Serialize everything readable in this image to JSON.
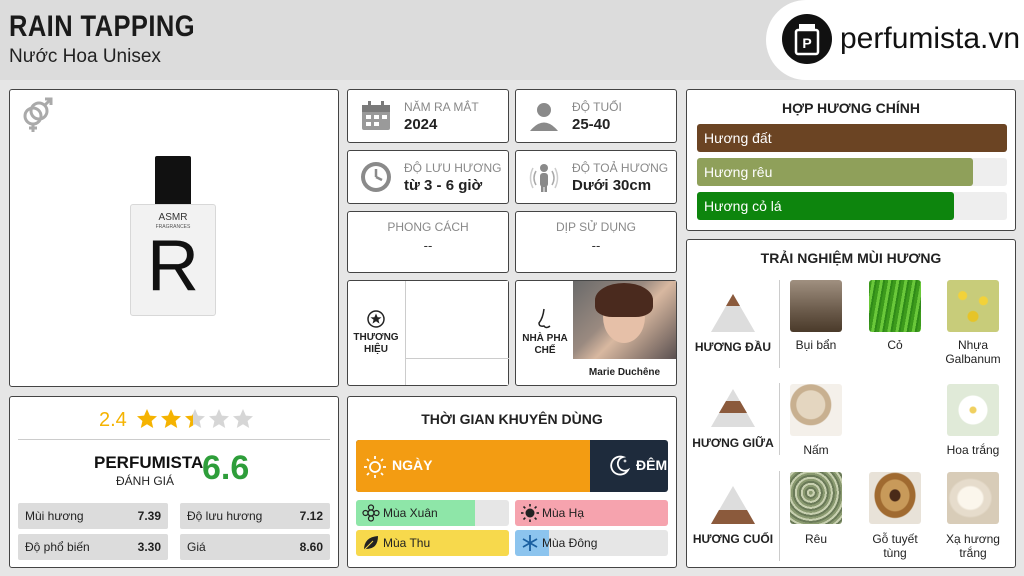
{
  "header": {
    "title": "RAIN TAPPING",
    "subtitle": "Nước Hoa Unisex",
    "logo_text": "perfumista.vn"
  },
  "product": {
    "bottle_brand": "ASMR",
    "bottle_sub": "FRAGRANCES",
    "bottle_letter": "R",
    "gender_icon": "unisex-gender-icon"
  },
  "info": {
    "launch": {
      "label": "NĂM RA MẮT",
      "value": "2024",
      "icon": "calendar-icon"
    },
    "age": {
      "label": "ĐỘ TUỔI",
      "value": "25-40",
      "icon": "person-icon"
    },
    "longevity": {
      "label": "ĐỘ LƯU HƯƠNG",
      "value": "từ 3 - 6 giờ",
      "icon": "clock-icon"
    },
    "sillage": {
      "label": "ĐỘ TOẢ HƯƠNG",
      "value": "Dưới 30cm",
      "icon": "sillage-icon"
    },
    "style": {
      "label": "PHONG CÁCH",
      "value": "--"
    },
    "occasion": {
      "label": "DỊP SỬ DỤNG",
      "value": "--"
    },
    "brand_label": "THƯƠNG HIỆU",
    "perfumer_label": "NHÀ PHA CHẾ",
    "perfumer_name": "Marie Duchêne"
  },
  "accords": {
    "title": "HỢP HƯƠNG CHÍNH",
    "items": [
      {
        "name": "Hương đất",
        "percent": 100,
        "color": "#6b4423"
      },
      {
        "name": "Hương rêu",
        "percent": 89,
        "color": "#8fa05a"
      },
      {
        "name": "Hương cỏ lá",
        "percent": 83,
        "color": "#0d850d"
      }
    ]
  },
  "rating": {
    "score": "2.4",
    "stars": 2.4,
    "brand": "PERFUMISTA",
    "brand_sub": "ĐÁNH GIÁ",
    "big_score": "6.6",
    "rows": [
      {
        "label": "Mùi hương",
        "value": "7.39"
      },
      {
        "label": "Độ lưu hương",
        "value": "7.12"
      },
      {
        "label": "Độ phổ biến",
        "value": "3.30"
      },
      {
        "label": "Giá",
        "value": "8.60"
      }
    ]
  },
  "time": {
    "title": "THỜI GIAN KHUYÊN DÙNG",
    "day_label": "NGÀY",
    "night_label": "ĐÊM",
    "day_percent": 75,
    "seasons": [
      {
        "label": "Mùa Xuân",
        "percent": 78,
        "color": "#8ee6a8"
      },
      {
        "label": "Mùa Hạ",
        "percent": 100,
        "color": "#f6a3ae"
      },
      {
        "label": "Mùa Thu",
        "percent": 100,
        "color": "#f7d94c"
      },
      {
        "label": "Mùa Đông",
        "percent": 22,
        "color": "#8cc4ee"
      }
    ]
  },
  "notes": {
    "title": "TRẢI NGHIỆM MÙI HƯƠNG",
    "top_label": "HƯƠNG ĐẦU",
    "mid_label": "HƯƠNG GIỮA",
    "base_label": "HƯƠNG CUỐI",
    "top": [
      "Bụi bẩn",
      "Cỏ",
      "Nhựa Galbanum"
    ],
    "middle": [
      "Nấm",
      "Hoa trắng"
    ],
    "base": [
      "Rêu",
      "Gỗ tuyết tùng",
      "Xạ hương trắng"
    ]
  },
  "colors": {
    "day": "#f39c12",
    "night": "#1e2b3c",
    "score_green": "#2e9e3a",
    "star": "#f5b301"
  }
}
